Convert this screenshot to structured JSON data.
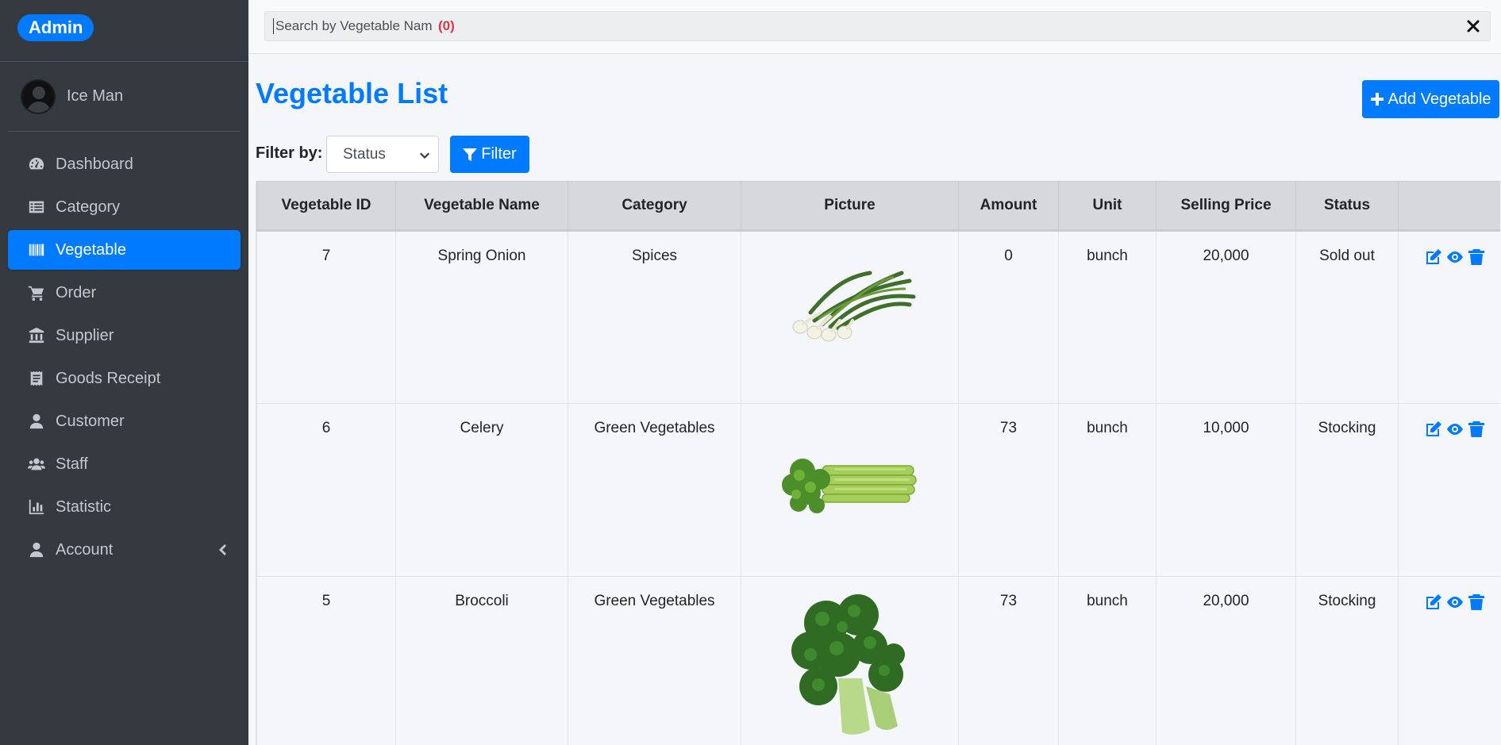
{
  "brand": {
    "label": "Admin"
  },
  "user": {
    "name": "Ice Man"
  },
  "sidebar": {
    "items": [
      {
        "label": "Dashboard",
        "icon": "dashboard-icon",
        "active": false
      },
      {
        "label": "Category",
        "icon": "list-icon",
        "active": false
      },
      {
        "label": "Vegetable",
        "icon": "barcode-icon",
        "active": true
      },
      {
        "label": "Order",
        "icon": "cart-icon",
        "active": false
      },
      {
        "label": "Supplier",
        "icon": "bank-icon",
        "active": false
      },
      {
        "label": "Goods Receipt",
        "icon": "receipt-icon",
        "active": false
      },
      {
        "label": "Customer",
        "icon": "user-tie-icon",
        "active": false
      },
      {
        "label": "Staff",
        "icon": "users-icon",
        "active": false
      },
      {
        "label": "Statistic",
        "icon": "chart-icon",
        "active": false
      },
      {
        "label": "Account",
        "icon": "user-icon",
        "active": false
      }
    ]
  },
  "search": {
    "placeholder": "Search by Vegetable Name",
    "count": "(0)"
  },
  "page": {
    "title": "Vegetable List",
    "add_label": "Add Vegetable",
    "filter_label": "Filter by:",
    "filter_select": "Status",
    "filter_button": "Filter"
  },
  "table": {
    "headers": [
      "Vegetable ID",
      "Vegetable Name",
      "Category",
      "Picture",
      "Amount",
      "Unit",
      "Selling Price",
      "Status",
      ""
    ],
    "rows": [
      {
        "id": "7",
        "name": "Spring Onion",
        "category": "Spices",
        "picture": "spring-onion-image",
        "amount": "0",
        "unit": "bunch",
        "price": "20,000",
        "status": "Sold out"
      },
      {
        "id": "6",
        "name": "Celery",
        "category": "Green Vegetables",
        "picture": "celery-image",
        "amount": "73",
        "unit": "bunch",
        "price": "10,000",
        "status": "Stocking"
      },
      {
        "id": "5",
        "name": "Broccoli",
        "category": "Green Vegetables",
        "picture": "broccoli-image",
        "amount": "73",
        "unit": "bunch",
        "price": "20,000",
        "status": "Stocking"
      }
    ]
  },
  "colors": {
    "accent": "#007bff",
    "sidebar": "#343a40",
    "danger": "#dc3545"
  }
}
